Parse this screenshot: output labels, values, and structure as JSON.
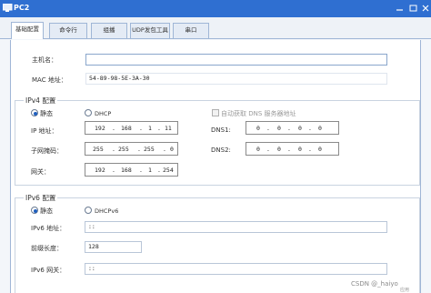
{
  "window": {
    "title": "PC2"
  },
  "tabs": [
    {
      "label": "基础配置"
    },
    {
      "label": "命令行"
    },
    {
      "label": "组播"
    },
    {
      "label": "UDP发包工具"
    },
    {
      "label": "串口"
    }
  ],
  "basic": {
    "hostname_label": "主机名：",
    "hostname_value": "",
    "mac_label": "MAC 地址：",
    "mac_value": "54-89-98-5E-3A-30"
  },
  "ipv4": {
    "section_title": "IPv4 配置",
    "static_label": "静态",
    "dhcp_label": "DHCP",
    "auto_dns_label": "自动获取 DNS 服务器地址",
    "ip_label": "IP 地址：",
    "ip": [
      "192",
      "168",
      "1",
      "11"
    ],
    "mask_label": "子网掩码：",
    "mask": [
      "255",
      "255",
      "255",
      "0"
    ],
    "gateway_label": "网关：",
    "gateway": [
      "192",
      "168",
      "1",
      "254"
    ],
    "dns1_label": "DNS1:",
    "dns1": [
      "0",
      "0",
      "0",
      "0"
    ],
    "dns2_label": "DNS2:",
    "dns2": [
      "0",
      "0",
      "0",
      "0"
    ],
    "mode": "static"
  },
  "ipv6": {
    "section_title": "IPv6 配置",
    "static_label": "静态",
    "dhcpv6_label": "DHCPv6",
    "addr_label": "IPv6 地址：",
    "addr_value": "::",
    "prefix_label": "前缀长度：",
    "prefix_value": "128",
    "gateway_label": "IPv6 网关：",
    "gateway_value": "::",
    "mode": "static"
  },
  "watermark": {
    "text": "CSDN @_haiyo",
    "apply_label": "应用"
  },
  "colors": {
    "titlebar": "#2f6fd1",
    "radio_selected": "#1f5fbf"
  }
}
